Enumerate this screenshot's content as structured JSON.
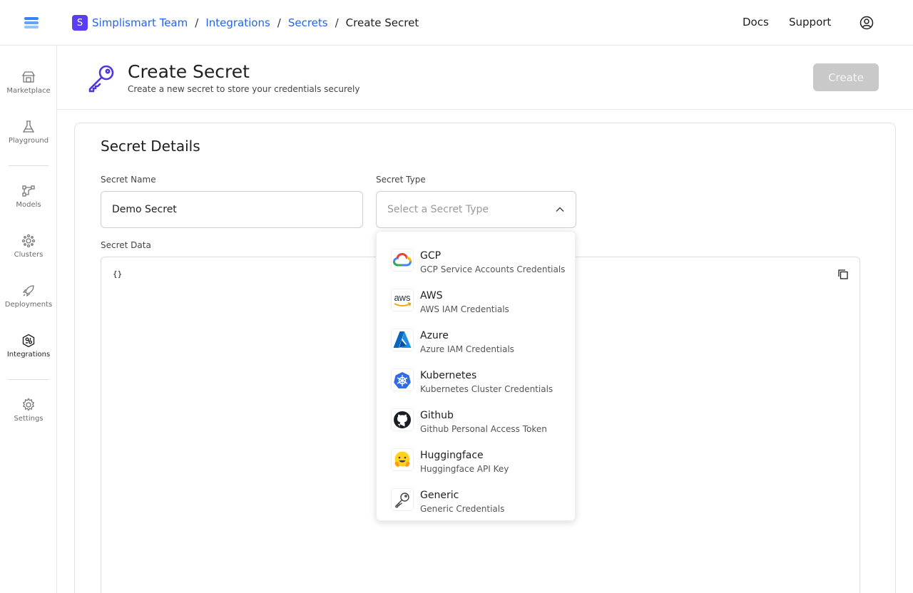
{
  "header": {
    "team_badge": "S",
    "breadcrumb": {
      "team": "Simplismart Team",
      "integrations": "Integrations",
      "secrets": "Secrets",
      "current": "Create Secret",
      "separator": "/"
    },
    "docs": "Docs",
    "support": "Support"
  },
  "sidebar": {
    "items": [
      {
        "label": "Marketplace",
        "icon": "store-icon"
      },
      {
        "label": "Playground",
        "icon": "flask-icon"
      },
      {
        "label": "Models",
        "icon": "model-graph-icon"
      },
      {
        "label": "Clusters",
        "icon": "cluster-icon"
      },
      {
        "label": "Deployments",
        "icon": "rocket-icon"
      },
      {
        "label": "Integrations",
        "icon": "integrations-icon",
        "active": true
      },
      {
        "label": "Settings",
        "icon": "gear-icon"
      }
    ]
  },
  "page": {
    "title": "Create Secret",
    "subtitle": "Create a new secret to store your credentials securely",
    "create_label": "Create"
  },
  "form": {
    "section_title": "Secret Details",
    "name_label": "Secret Name",
    "name_value": "Demo Secret",
    "type_label": "Secret Type",
    "type_placeholder": "Select a Secret Type",
    "data_label": "Secret Data",
    "data_value": "{}"
  },
  "secret_types": [
    {
      "name": "GCP",
      "desc": "GCP Service Accounts Credentials",
      "icon": "gcp-icon"
    },
    {
      "name": "AWS",
      "desc": "AWS IAM Credentials",
      "icon": "aws-icon",
      "icon_text": "aws"
    },
    {
      "name": "Azure",
      "desc": "Azure IAM Credentials",
      "icon": "azure-icon"
    },
    {
      "name": "Kubernetes",
      "desc": "Kubernetes Cluster Credentials",
      "icon": "kubernetes-icon"
    },
    {
      "name": "Github",
      "desc": "Github Personal Access Token",
      "icon": "github-icon"
    },
    {
      "name": "Huggingface",
      "desc": "Huggingface API Key",
      "icon": "huggingface-icon"
    },
    {
      "name": "Generic",
      "desc": "Generic Credentials",
      "icon": "key-icon"
    }
  ],
  "colors": {
    "accent": "#5b3ef3",
    "link": "#2563eb",
    "disabled_button": "#c9c9c9"
  }
}
